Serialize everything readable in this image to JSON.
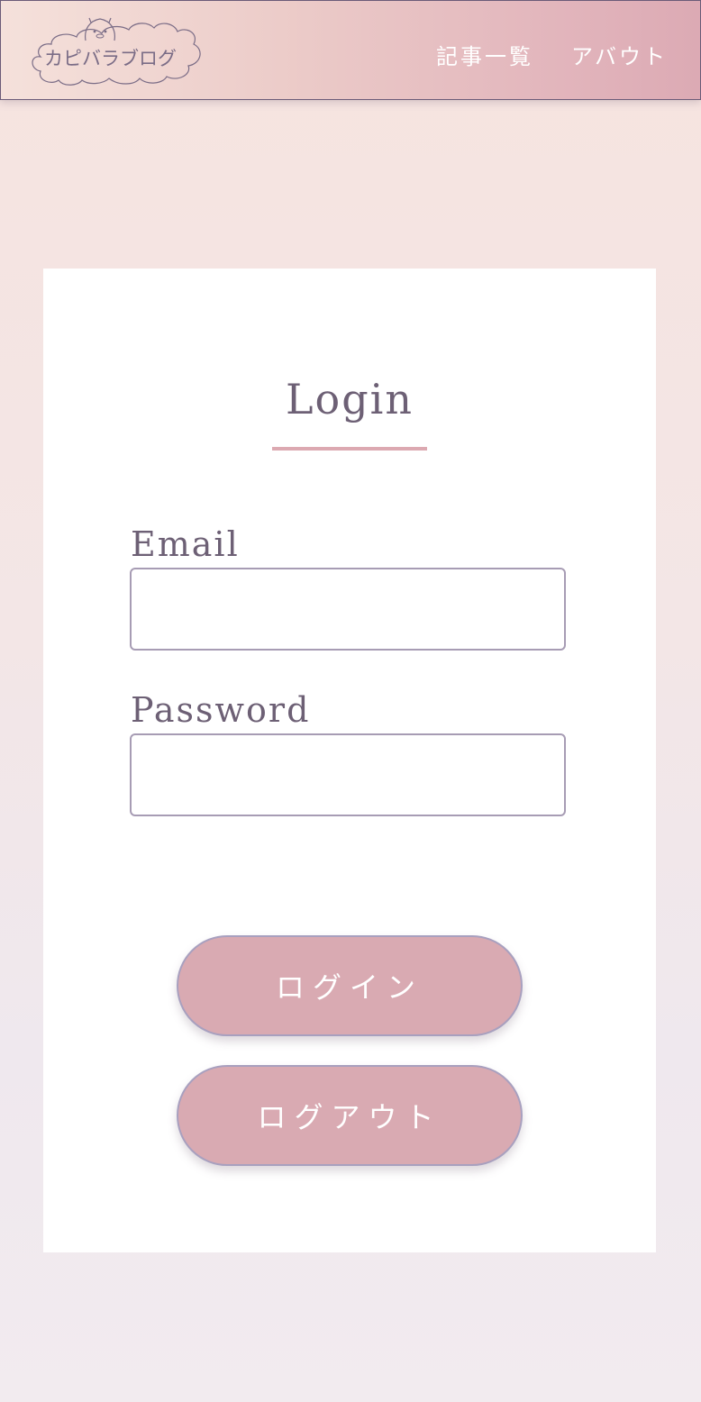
{
  "header": {
    "logo_text": "カピバラブログ",
    "nav": [
      {
        "label": "記事一覧"
      },
      {
        "label": "アバウト"
      }
    ]
  },
  "login": {
    "title": "Login",
    "email_label": "Email",
    "email_value": "",
    "password_label": "Password",
    "password_value": "",
    "login_button": "ログイン",
    "logout_button": "ログアウト"
  },
  "colors": {
    "text": "#6d6075",
    "button_bg": "#d9aab2",
    "button_border": "#a8a0bf",
    "accent_underline": "#dca9b1",
    "input_border": "#a79cb4"
  },
  "icons": {
    "logo": "capybara-cloud-logo-icon"
  }
}
